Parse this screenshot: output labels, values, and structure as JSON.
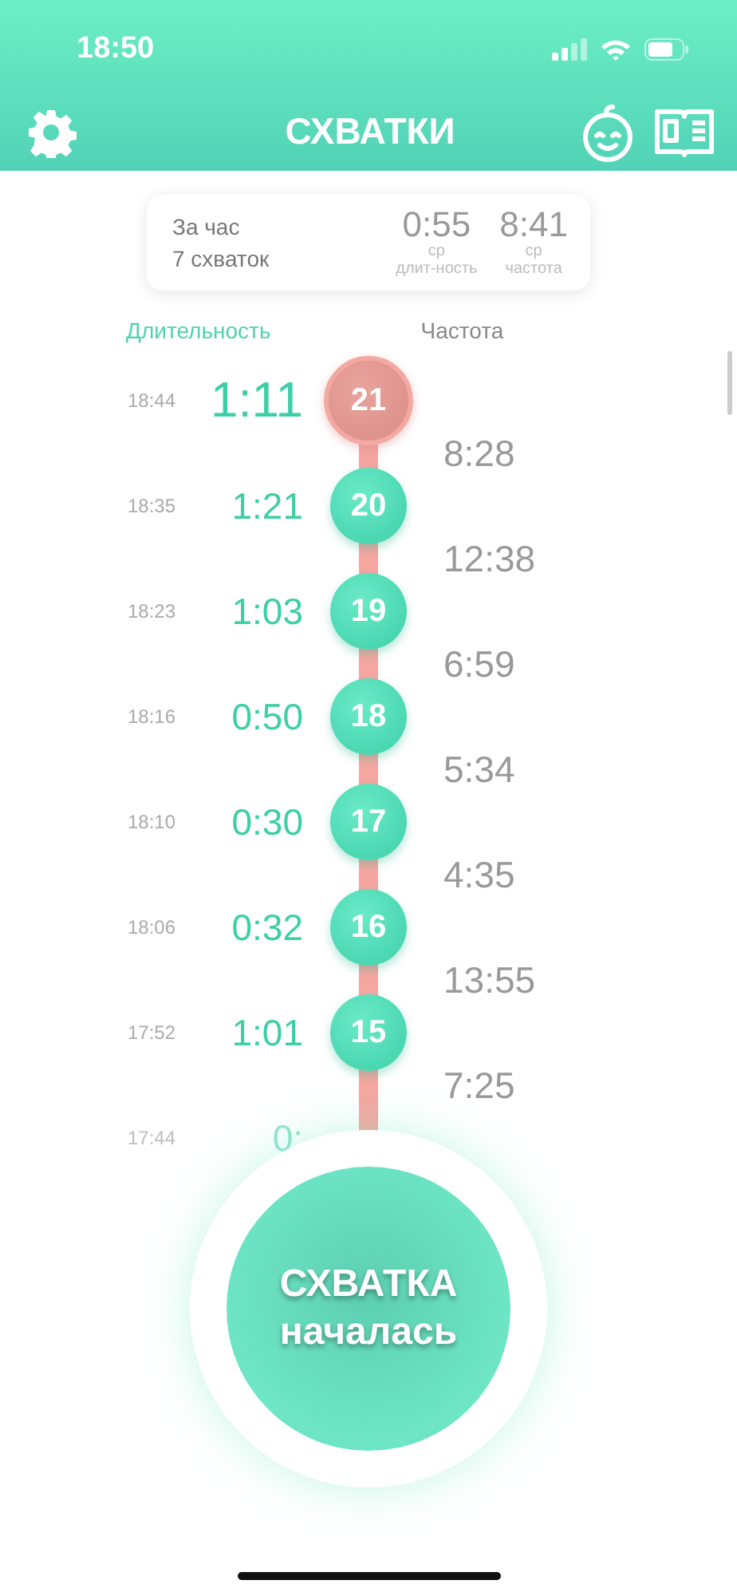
{
  "status_bar": {
    "time": "18:50"
  },
  "header": {
    "title": "СХВАТКИ"
  },
  "summary": {
    "period": "За час",
    "count": "7 схваток",
    "stats": [
      {
        "value": "0:55",
        "caption_1": "ср",
        "caption_2": "длит-ность"
      },
      {
        "value": "8:41",
        "caption_1": "ср",
        "caption_2": "частота"
      }
    ]
  },
  "columns": {
    "duration": "Длительность",
    "frequency": "Частота"
  },
  "contractions": [
    {
      "time": "18:44",
      "duration": "1:11",
      "number": "21",
      "selected": true,
      "faded": false
    },
    {
      "time": "18:35",
      "duration": "1:21",
      "number": "20",
      "selected": false,
      "faded": false
    },
    {
      "time": "18:23",
      "duration": "1:03",
      "number": "19",
      "selected": false,
      "faded": false
    },
    {
      "time": "18:16",
      "duration": "0:50",
      "number": "18",
      "selected": false,
      "faded": false
    },
    {
      "time": "18:10",
      "duration": "0:30",
      "number": "17",
      "selected": false,
      "faded": false
    },
    {
      "time": "18:06",
      "duration": "0:32",
      "number": "16",
      "selected": false,
      "faded": false
    },
    {
      "time": "17:52",
      "duration": "1:01",
      "number": "15",
      "selected": false,
      "faded": false
    },
    {
      "time": "17:44",
      "duration": "0:",
      "selected": false,
      "faded": true
    }
  ],
  "intervals": [
    "8:28",
    "12:38",
    "6:59",
    "5:34",
    "4:35",
    "13:55",
    "7:25"
  ],
  "start_button": {
    "line_1": "СХВАТКА",
    "line_2": "началась"
  }
}
